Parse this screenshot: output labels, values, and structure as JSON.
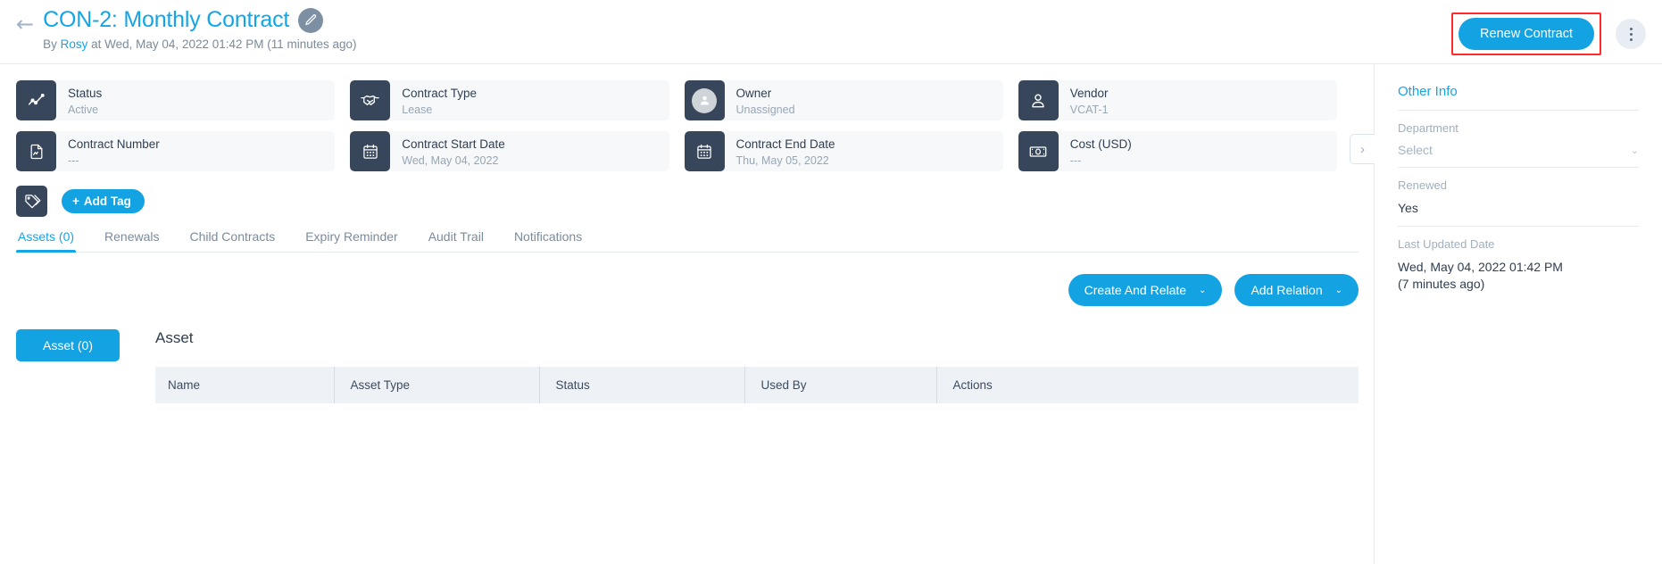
{
  "header": {
    "back_icon": "arrow-left-icon",
    "title": "CON-2: Monthly Contract",
    "edit_icon": "pencil-icon",
    "subtitle_prefix": "By ",
    "subtitle_user": "Rosy",
    "subtitle_suffix": " at Wed, May 04, 2022 01:42 PM (11 minutes ago)",
    "renew_button": "Renew Contract",
    "kebab_icon": "more-vertical-icon",
    "accent_color": "#13a3e3",
    "highlight_color": "#ff2b2b"
  },
  "info_cards": [
    {
      "icon": "chart-line-icon",
      "label": "Status",
      "value": "Active"
    },
    {
      "icon": "handshake-icon",
      "label": "Contract Type",
      "value": "Lease"
    },
    {
      "icon": "user-avatar-icon",
      "label": "Owner",
      "value": "Unassigned"
    },
    {
      "icon": "user-icon",
      "label": "Vendor",
      "value": "VCAT-1"
    },
    {
      "icon": "document-icon",
      "label": "Contract Number",
      "value": "---"
    },
    {
      "icon": "calendar-icon",
      "label": "Contract Start Date",
      "value": "Wed, May 04, 2022"
    },
    {
      "icon": "calendar-icon",
      "label": "Contract End Date",
      "value": "Thu, May 05, 2022"
    },
    {
      "icon": "money-bill-icon",
      "label": "Cost (USD)",
      "value": "---"
    }
  ],
  "collapse": {
    "icon": "chevron-right-icon"
  },
  "tag_row": {
    "icon": "tags-icon",
    "add_tag_plus": "+",
    "add_tag_label": "Add Tag"
  },
  "tabs": [
    {
      "label": "Assets (0)",
      "active": true
    },
    {
      "label": "Renewals",
      "active": false
    },
    {
      "label": "Child Contracts",
      "active": false
    },
    {
      "label": "Expiry Reminder",
      "active": false
    },
    {
      "label": "Audit Trail",
      "active": false
    },
    {
      "label": "Notifications",
      "active": false
    }
  ],
  "actions": {
    "create_and_relate": "Create And Relate",
    "add_relation": "Add Relation",
    "chevron": "⌄"
  },
  "asset_panel": {
    "pill_label": "Asset (0)",
    "heading": "Asset",
    "columns": [
      "Name",
      "Asset Type",
      "Status",
      "Used By",
      "Actions"
    ],
    "rows": []
  },
  "other_info": {
    "title": "Other Info",
    "department_label": "Department",
    "department_value": "Select",
    "department_chevron": "⌄",
    "renewed_label": "Renewed",
    "renewed_value": "Yes",
    "last_updated_label": "Last Updated Date",
    "last_updated_value": "Wed, May 04, 2022 01:42 PM",
    "last_updated_relative": "(7 minutes ago)"
  }
}
